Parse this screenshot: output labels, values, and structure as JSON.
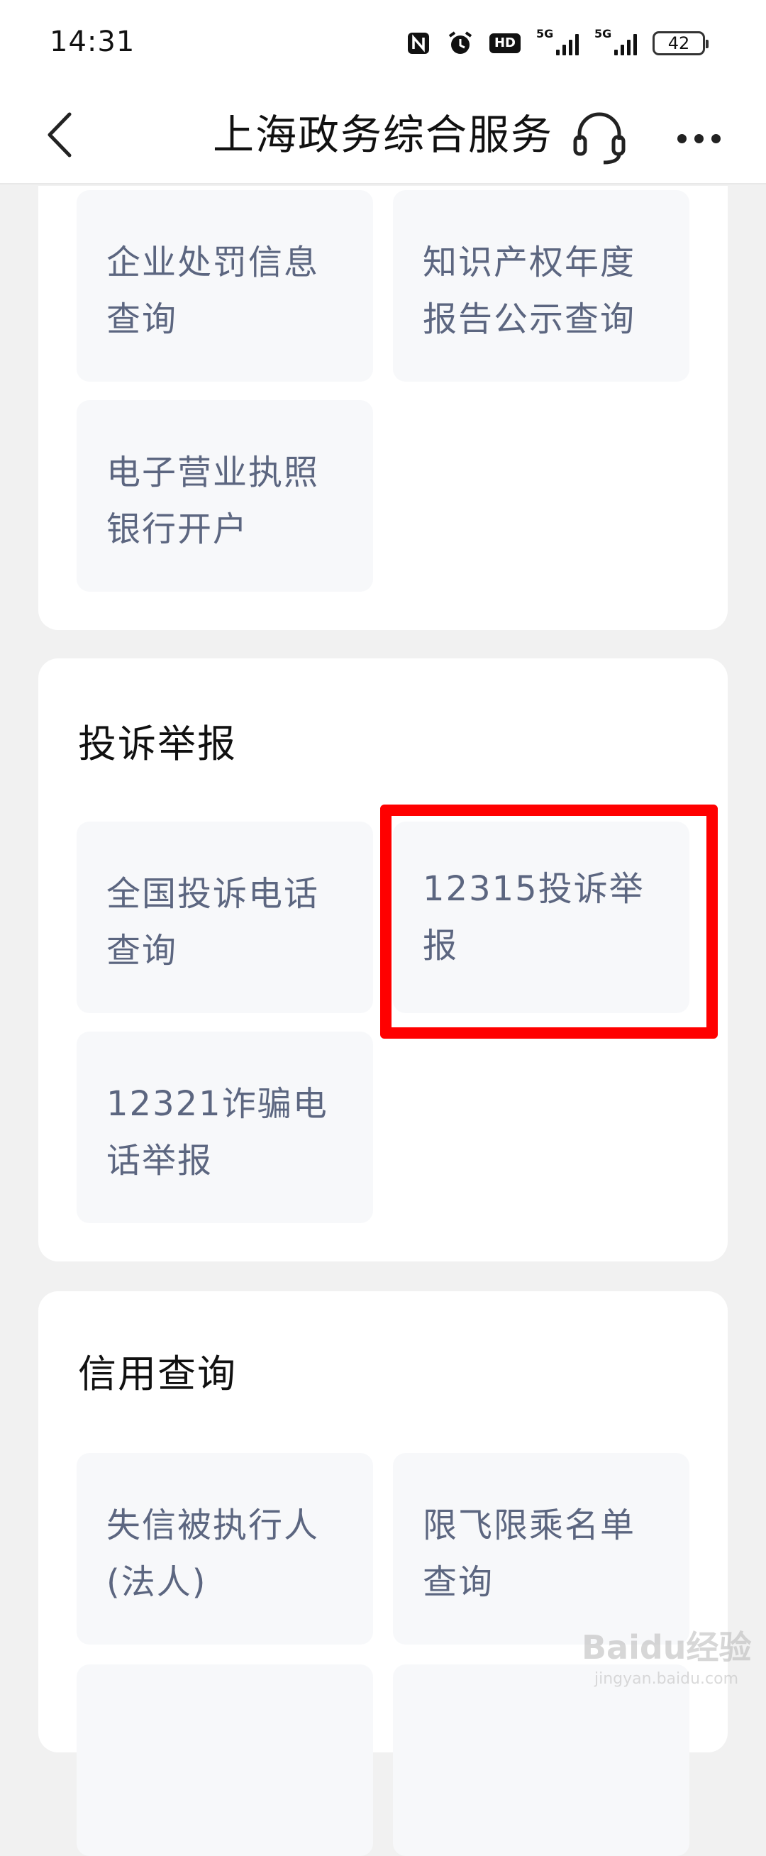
{
  "status_bar": {
    "time": "14:31",
    "hd_label": "HD",
    "signal1_label": "5G",
    "signal2_label": "5G",
    "battery": "42"
  },
  "nav": {
    "title": "上海政务综合服务"
  },
  "section_top": {
    "tiles": [
      {
        "label": "企业处罚信息查询"
      },
      {
        "label": "知识产权年度报告公示查询"
      },
      {
        "label": "电子营业执照银行开户"
      }
    ]
  },
  "section_complaint": {
    "title": "投诉举报",
    "tiles": [
      {
        "label": "全国投诉电话查询"
      },
      {
        "label": "12315投诉举报"
      },
      {
        "label": "12321诈骗电话举报"
      }
    ]
  },
  "section_credit": {
    "title": "信用查询",
    "tiles": [
      {
        "label": "失信被执行人(法人)"
      },
      {
        "label": "限飞限乘名单查询"
      }
    ]
  },
  "watermark": {
    "brand": "Baidu经验",
    "url": "jingyan.baidu.com"
  },
  "colors": {
    "highlight": "#ff0000",
    "tile_bg": "#f7f8fa",
    "tile_text": "#5c6680"
  }
}
